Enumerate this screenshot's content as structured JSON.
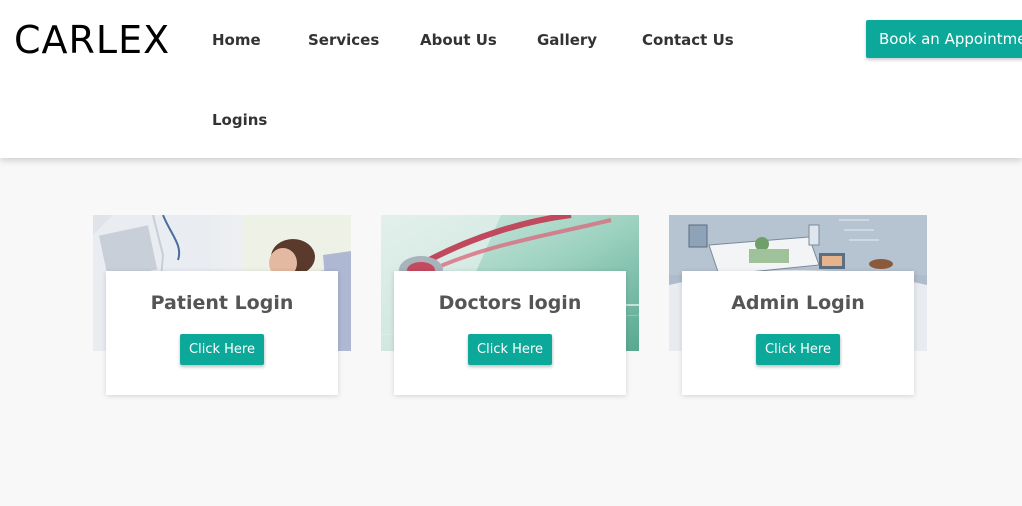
{
  "brand": {
    "logo": "CARLEX"
  },
  "nav": {
    "items": [
      {
        "label": "Home"
      },
      {
        "label": "Services"
      },
      {
        "label": "About Us"
      },
      {
        "label": "Gallery"
      },
      {
        "label": "Contact Us"
      },
      {
        "label": "Logins"
      }
    ],
    "cta_label": "Book an Appointment"
  },
  "colors": {
    "accent": "#0ca99a",
    "background": "#f8f8f8"
  },
  "cards": [
    {
      "title": "Patient Login",
      "button": "Click Here",
      "image": "doctor-with-patient-photo"
    },
    {
      "title": "Doctors login",
      "button": "Click Here",
      "image": "stethoscope-photo"
    },
    {
      "title": "Admin Login",
      "button": "Click Here",
      "image": "hospital-illustration"
    }
  ]
}
